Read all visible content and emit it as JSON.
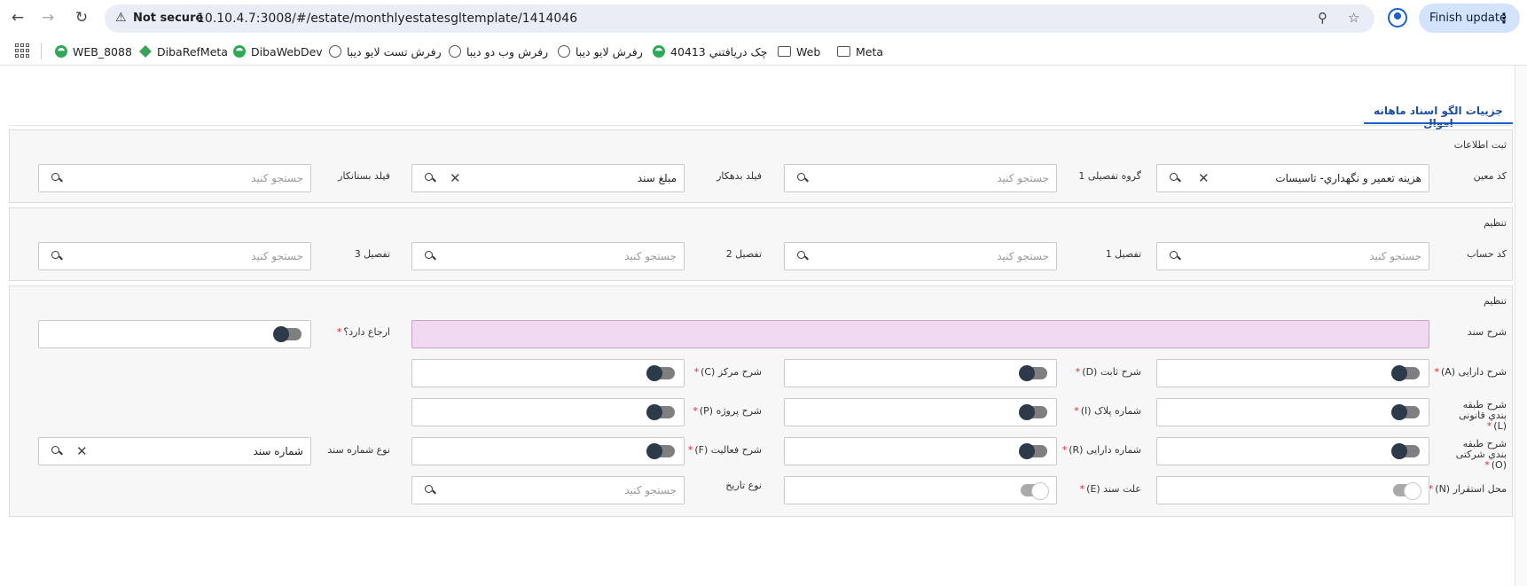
{
  "browser": {
    "not_secure_label": "Not secure",
    "url": "10.10.4.7:3008/#/estate/monthlyestatesgltemplate/1414046",
    "finish_update_label": "Finish update",
    "bookmarks": [
      {
        "label": "WEB_8088",
        "icon": "web-logo-icon"
      },
      {
        "label": "DibaRefMeta",
        "icon": "diba-icon"
      },
      {
        "label": "DibaWebDev",
        "icon": "web-logo-icon"
      },
      {
        "label": "رفرش تست لایو دیبا",
        "icon": "globe-icon"
      },
      {
        "label": "رفرش وب دو دیبا",
        "icon": "globe-icon"
      },
      {
        "label": "رفرش لایو دیبا",
        "icon": "globe-icon"
      },
      {
        "label": "چک دريافتني 40413",
        "icon": "web-logo-icon"
      },
      {
        "label": "Web",
        "icon": "folder-icon"
      },
      {
        "label": "Meta",
        "icon": "folder-icon"
      }
    ]
  },
  "page": {
    "tab_label": "جزییات الگو اسناد ماهانه اموال"
  },
  "panel1": {
    "title": "ثبت اطلاعات",
    "moein_label": "کد معین",
    "moein_value": "هزینه تعمیر و نگهداري- تاسیسات",
    "group_label": "گروه تفصیلی 1",
    "group_placeholder": "جستجو کنید",
    "debtor_label": "فیلد بدهکار",
    "debtor_value": "مبلغ سند",
    "creditor_label": "فیلد بستانکار",
    "creditor_placeholder": "جستجو کنید"
  },
  "panel2": {
    "title": "تنظیم",
    "account_label": "کد حساب",
    "account_placeholder": "جستجو کنید",
    "tafsil1_label": "تفصیل 1",
    "tafsil1_placeholder": "جستجو کنید",
    "tafsil2_label": "تفصیل 2",
    "tafsil2_placeholder": "جستجو کنید",
    "tafsil3_label": "تفصیل 3",
    "tafsil3_placeholder": "جستجو کنید"
  },
  "panel3": {
    "title": "تنظیم",
    "doc_desc_label": "شرح سند",
    "has_reference_label": "ارجاع دارد؟",
    "asset_desc_label": "شرح دارایی (A)",
    "fixed_desc_label": "شرح ثابت (D)",
    "center_desc_label": "شرح مرکز (C)",
    "legal_class_label": "شرح طبقه بندي قانونی (L)",
    "plate_no_label": "شماره پلاک (I)",
    "project_desc_label": "شرح پروژه (P)",
    "company_class_label": "شرح طبقه بندي شرکتی (O)",
    "asset_no_label": "شماره دارایی (R)",
    "activity_desc_label": "شرح فعالیت (F)",
    "doc_number_type_label": "نوع شماره سند",
    "doc_number_type_value": "شماره سند",
    "location_label": "محل استقرار (N)",
    "reason_label": "علت سند (E)",
    "date_type_label": "نوع تاریخ",
    "date_type_placeholder": "جستجو کنید"
  }
}
